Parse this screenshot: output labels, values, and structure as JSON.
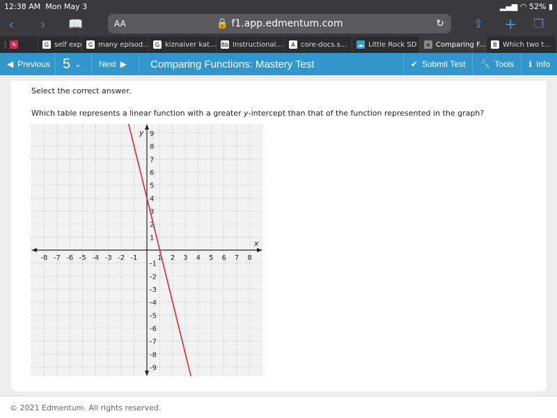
{
  "status": {
    "time": "12:38 AM",
    "date": "Mon May 3",
    "battery": "52%"
  },
  "browser": {
    "aa": "AA",
    "url": "f1.app.edmentum.com",
    "tabs": [
      {
        "label": "self expla",
        "fav": "G"
      },
      {
        "label": "many episod...",
        "fav": "G"
      },
      {
        "label": "kiznaiver kat...",
        "fav": "G"
      },
      {
        "label": "Instructional...",
        "fav": "Bb"
      },
      {
        "label": "core-docs.s...",
        "fav": "A"
      },
      {
        "label": "Little Rock SD",
        "fav": "☁"
      },
      {
        "label": "Comparing F...",
        "fav": "×"
      },
      {
        "label": "Which two t...",
        "fav": "B"
      }
    ]
  },
  "toolbar": {
    "previous": "Previous",
    "question_number": "5",
    "next": "Next",
    "title": "Comparing Functions: Mastery Test",
    "submit": "Submit Test",
    "tools": "Tools",
    "info": "Info",
    "accent": "#3296cd"
  },
  "question": {
    "instruction": "Select the correct answer.",
    "prompt_pre": "Which table represents a linear function with a greater ",
    "prompt_var": "y",
    "prompt_post": "-intercept than that of the function represented in the graph?"
  },
  "chart_data": {
    "type": "line",
    "xlabel": "x",
    "ylabel": "y",
    "xlim": [
      -9,
      9
    ],
    "ylim": [
      -9.7,
      9.7
    ],
    "xticks": [
      -8,
      -7,
      -6,
      -5,
      -4,
      -3,
      -2,
      -1,
      1,
      2,
      3,
      4,
      5,
      6,
      7,
      8
    ],
    "yticks": [
      -9,
      -8,
      -7,
      -6,
      -5,
      -4,
      -3,
      -2,
      -1,
      1,
      2,
      3,
      4,
      5,
      6,
      7,
      8,
      9
    ],
    "grid": true,
    "line": {
      "slope": -4,
      "intercept": 4,
      "color": "#d62a2a"
    }
  },
  "footer": "© 2021 Edmentum. All rights reserved."
}
